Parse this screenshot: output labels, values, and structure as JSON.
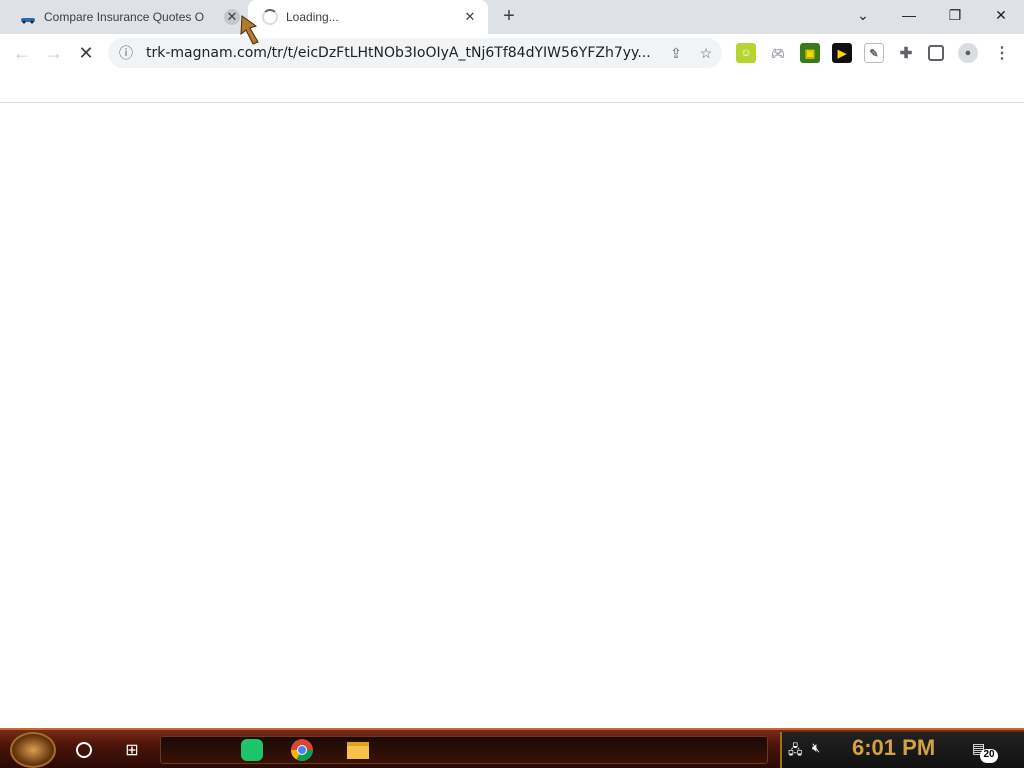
{
  "tabs": [
    {
      "title": "Compare Insurance Quotes On",
      "close": "✕"
    },
    {
      "title": "Loading...",
      "close": "✕"
    }
  ],
  "new_tab": "+",
  "window_controls": {
    "tab_search": "⌄",
    "minimize": "—",
    "restore": "❐",
    "close": "✕"
  },
  "toolbar": {
    "back": "←",
    "forward": "→",
    "stop": "✕",
    "url": "trk-magnam.com/tr/t/eicDzFtLHtNOb3IoOIyA_tNj6Tf84dYIW56YFZh7yy...",
    "site_info": "ⓘ",
    "share": "⇪",
    "bookmark": "☆"
  },
  "taskbar": {
    "clock": "6:01 PM",
    "notifications": "20"
  },
  "colors": {
    "tabstrip": "#dee1e6",
    "taskbar_accent": "#c46a2a",
    "clock": "#d4a240"
  }
}
